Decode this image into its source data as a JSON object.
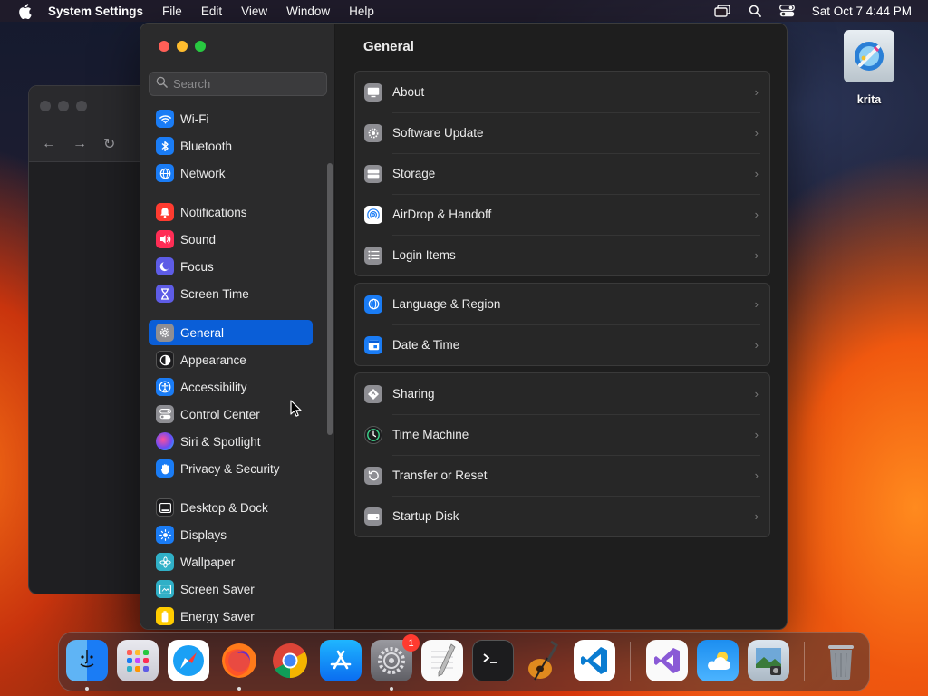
{
  "menubar": {
    "app_name": "System Settings",
    "menus": [
      "File",
      "Edit",
      "View",
      "Window",
      "Help"
    ],
    "clock": "Sat Oct 7  4:44 PM"
  },
  "search": {
    "placeholder": "Search"
  },
  "sidebar": {
    "items": [
      {
        "label": "Wi-Fi",
        "icon": "wifi-icon",
        "color": "#1a7cf5"
      },
      {
        "label": "Bluetooth",
        "icon": "bluetooth-icon",
        "color": "#1a7cf5"
      },
      {
        "label": "Network",
        "icon": "globe-icon",
        "color": "#1a7cf5"
      },
      {
        "label": "Notifications",
        "icon": "bell-icon",
        "color": "#ff3b30"
      },
      {
        "label": "Sound",
        "icon": "speaker-icon",
        "color": "#ff2d55"
      },
      {
        "label": "Focus",
        "icon": "moon-icon",
        "color": "#5e5ce6"
      },
      {
        "label": "Screen Time",
        "icon": "hourglass-icon",
        "color": "#5e5ce6"
      },
      {
        "label": "General",
        "icon": "gear-icon",
        "color": "#8e8e93"
      },
      {
        "label": "Appearance",
        "icon": "appearance-icon",
        "color": "#1c1c1e"
      },
      {
        "label": "Accessibility",
        "icon": "accessibility-icon",
        "color": "#1a7cf5"
      },
      {
        "label": "Control Center",
        "icon": "toggles-icon",
        "color": "#8e8e93"
      },
      {
        "label": "Siri & Spotlight",
        "icon": "siri-icon",
        "color": "#c644fc"
      },
      {
        "label": "Privacy & Security",
        "icon": "hand-icon",
        "color": "#1a7cf5"
      },
      {
        "label": "Desktop & Dock",
        "icon": "dock-icon",
        "color": "#1c1c1e"
      },
      {
        "label": "Displays",
        "icon": "sun-icon",
        "color": "#1a7cf5"
      },
      {
        "label": "Wallpaper",
        "icon": "flower-icon",
        "color": "#30b0c7"
      },
      {
        "label": "Screen Saver",
        "icon": "screensaver-icon",
        "color": "#30b0c7"
      },
      {
        "label": "Energy Saver",
        "icon": "battery-icon",
        "color": "#ffcc00"
      }
    ],
    "selected": "General"
  },
  "main": {
    "title": "General",
    "groups": [
      [
        {
          "label": "About",
          "icon": "computer-icon"
        },
        {
          "label": "Software Update",
          "icon": "gear-badge-icon"
        },
        {
          "label": "Storage",
          "icon": "drive-icon"
        },
        {
          "label": "AirDrop & Handoff",
          "icon": "airdrop-icon"
        },
        {
          "label": "Login Items",
          "icon": "list-icon"
        }
      ],
      [
        {
          "label": "Language & Region",
          "icon": "globe-icon"
        },
        {
          "label": "Date & Time",
          "icon": "calendar-icon"
        }
      ],
      [
        {
          "label": "Sharing",
          "icon": "sharing-icon"
        },
        {
          "label": "Time Machine",
          "icon": "time-machine-icon"
        },
        {
          "label": "Transfer or Reset",
          "icon": "reset-icon"
        },
        {
          "label": "Startup Disk",
          "icon": "disk-icon"
        }
      ]
    ]
  },
  "desktop": {
    "icon_label": "krita"
  },
  "dock": {
    "apps": [
      "Finder",
      "Launchpad",
      "Safari",
      "Firefox",
      "Chrome",
      "App Store",
      "System Settings",
      "TextEdit",
      "Terminal",
      "GarageBand",
      "VS Code",
      "Visual Studio",
      "Weather",
      "Preview",
      "Trash"
    ],
    "settings_badge": "1"
  }
}
